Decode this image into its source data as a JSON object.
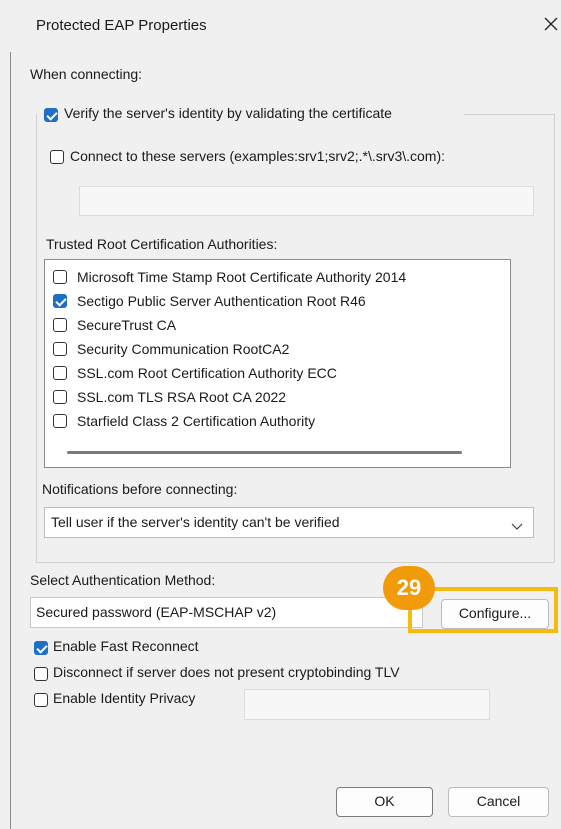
{
  "window": {
    "title": "Protected EAP Properties"
  },
  "when_connecting": {
    "label": "When connecting:",
    "verify_cert": {
      "label": "Verify the server's identity by validating the certificate",
      "checked": true
    },
    "connect_servers": {
      "label": "Connect to these servers (examples:srv1;srv2;.*\\.srv3\\.com):",
      "checked": false,
      "value": ""
    },
    "trusted_label": "Trusted Root Certification Authorities:",
    "authorities": [
      {
        "label": "Microsoft Time Stamp Root Certificate Authority 2014",
        "checked": false
      },
      {
        "label": "Sectigo Public Server Authentication Root R46",
        "checked": true
      },
      {
        "label": "SecureTrust CA",
        "checked": false
      },
      {
        "label": "Security Communication RootCA2",
        "checked": false
      },
      {
        "label": "SSL.com Root Certification Authority ECC",
        "checked": false
      },
      {
        "label": "SSL.com TLS RSA Root CA 2022",
        "checked": false
      },
      {
        "label": "Starfield Class 2 Certification Authority",
        "checked": false
      }
    ],
    "notifications_label": "Notifications before connecting:",
    "notifications_value": "Tell user if the server's identity can't be verified"
  },
  "auth": {
    "label": "Select Authentication Method:",
    "method_value": "Secured password (EAP-MSCHAP v2)",
    "configure_label": "Configure...",
    "fast_reconnect": {
      "label": "Enable Fast Reconnect",
      "checked": true
    },
    "cryptobinding": {
      "label": "Disconnect if server does not present cryptobinding TLV",
      "checked": false
    },
    "identity_privacy": {
      "label": "Enable Identity Privacy",
      "checked": false,
      "value": ""
    }
  },
  "buttons": {
    "ok": "OK",
    "cancel": "Cancel"
  },
  "annotation": {
    "step": "29",
    "color": "#f5bc0f",
    "badge_color": "#f19a0a"
  },
  "accent": "#1f6fc4"
}
